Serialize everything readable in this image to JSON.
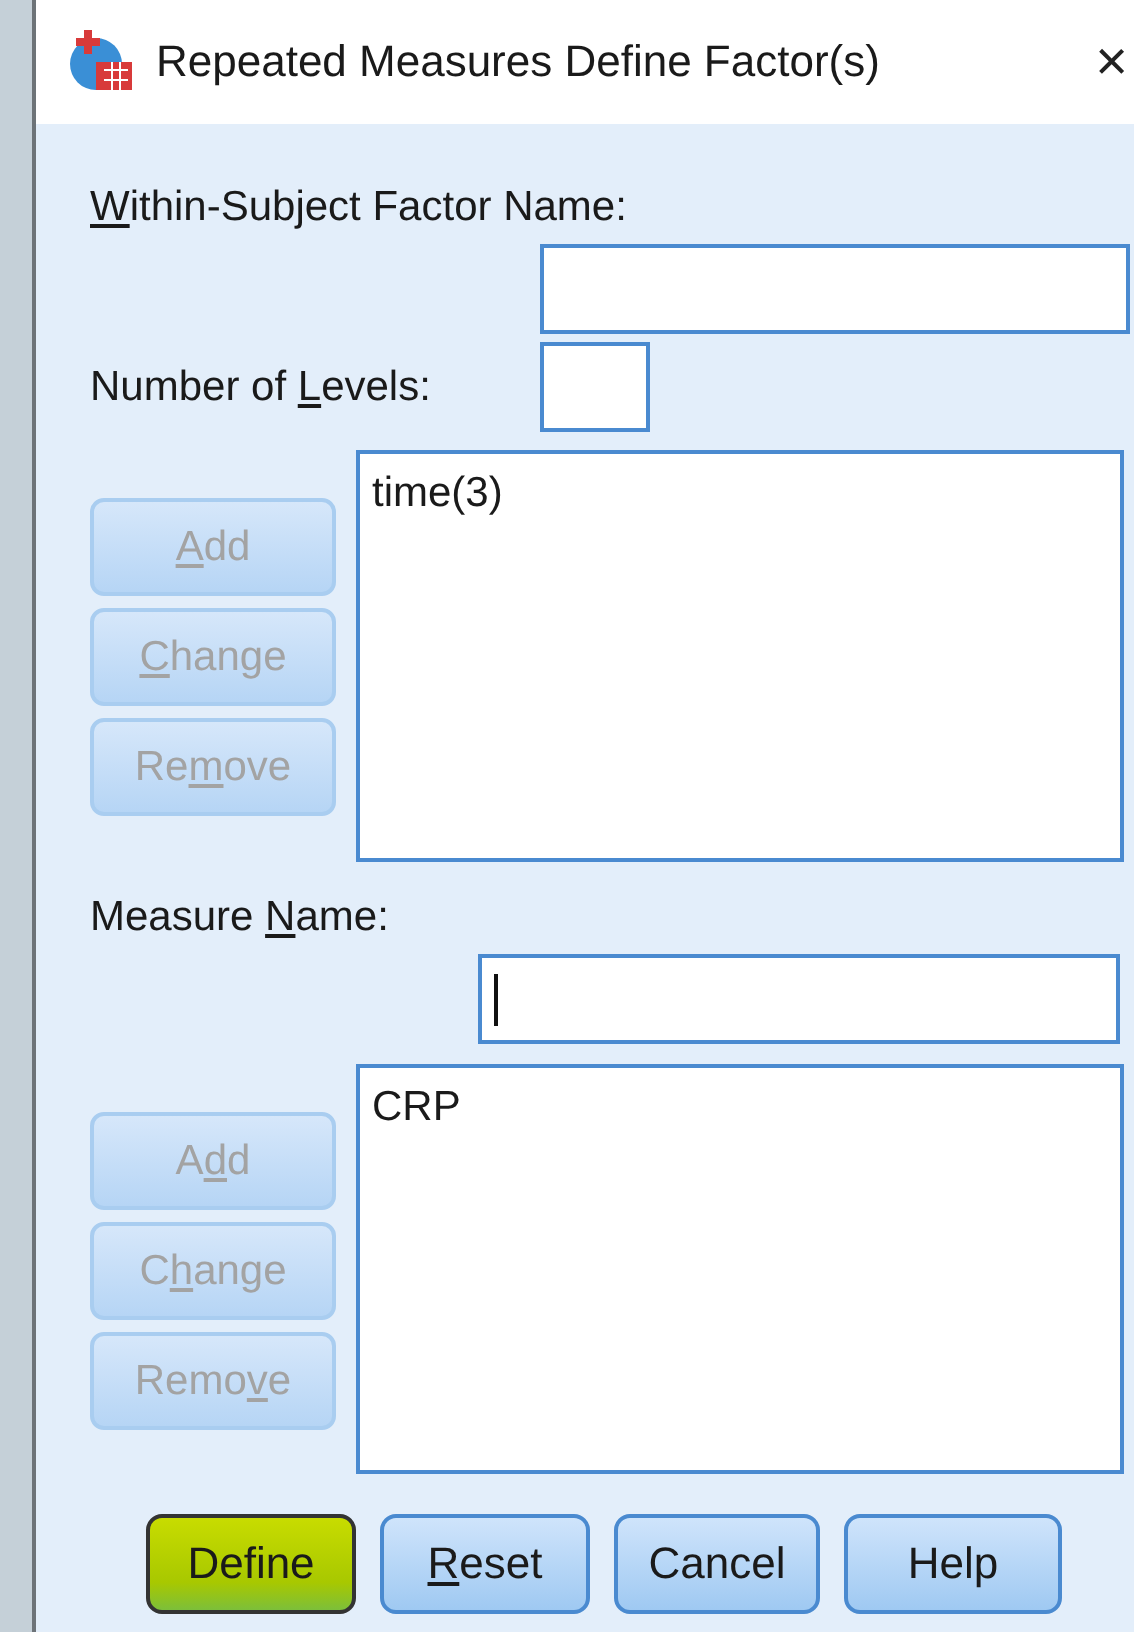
{
  "window": {
    "title": "Repeated Measures Define Factor(s)",
    "close": "×"
  },
  "factor_section": {
    "name_label": [
      {
        "text": "W",
        "underlined": true
      },
      {
        "text": "ithin-Subject Factor Name:",
        "underlined": false
      }
    ],
    "name_field": {
      "focused": false
    },
    "levels_label": [
      {
        "text": "Number of ",
        "underlined": false
      },
      {
        "text": "L",
        "underlined": true
      },
      {
        "text": "evels:",
        "underlined": false
      }
    ],
    "levels_field": {
      "focused": false
    },
    "buttons": [
      {
        "parts": [
          {
            "text": "A",
            "underlined": true
          },
          {
            "text": "dd",
            "underlined": false
          }
        ],
        "disabled": true
      },
      {
        "parts": [
          {
            "text": "C",
            "underlined": true
          },
          {
            "text": "hange",
            "underlined": false
          }
        ],
        "disabled": true
      },
      {
        "parts": [
          {
            "text": "Re",
            "underlined": false
          },
          {
            "text": "m",
            "underlined": true
          },
          {
            "text": "ove",
            "underlined": false
          }
        ],
        "disabled": true
      }
    ],
    "list": [
      "time(3)"
    ]
  },
  "measure_section": {
    "name_label": [
      {
        "text": "Measure ",
        "underlined": false
      },
      {
        "text": "N",
        "underlined": true
      },
      {
        "text": "ame:",
        "underlined": false
      }
    ],
    "name_field": {
      "focused": true
    },
    "buttons": [
      {
        "parts": [
          {
            "text": "A",
            "underlined": false
          },
          {
            "text": "d",
            "underlined": true
          },
          {
            "text": "d",
            "underlined": false
          }
        ],
        "disabled": true
      },
      {
        "parts": [
          {
            "text": "C",
            "underlined": false
          },
          {
            "text": "h",
            "underlined": true
          },
          {
            "text": "ange",
            "underlined": false
          }
        ],
        "disabled": true
      },
      {
        "parts": [
          {
            "text": "Remo",
            "underlined": false
          },
          {
            "text": "v",
            "underlined": true
          },
          {
            "text": "e",
            "underlined": false
          }
        ],
        "disabled": true
      }
    ],
    "list": [
      "CRP"
    ]
  },
  "footer_buttons": [
    {
      "parts": [
        {
          "text": "Define",
          "underlined": false
        }
      ],
      "highlighted": true
    },
    {
      "parts": [
        {
          "text": "R",
          "underlined": true
        },
        {
          "text": "eset",
          "underlined": false
        }
      ],
      "highlighted": false
    },
    {
      "parts": [
        {
          "text": "Cancel",
          "underlined": false
        }
      ],
      "highlighted": false
    },
    {
      "parts": [
        {
          "text": "Help",
          "underlined": false
        }
      ],
      "highlighted": false
    }
  ]
}
